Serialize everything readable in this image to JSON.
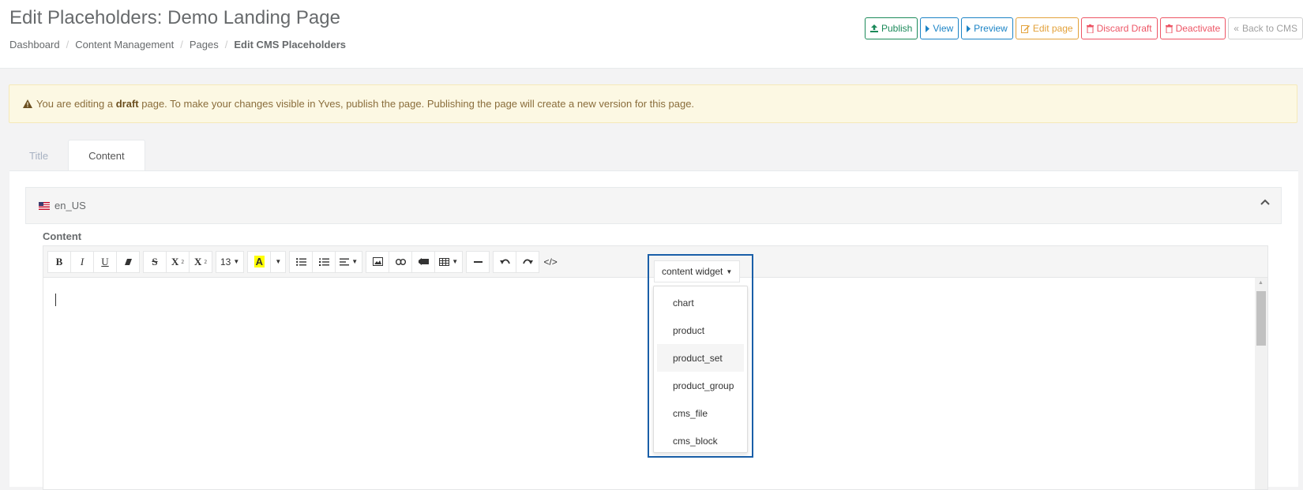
{
  "header": {
    "title": "Edit Placeholders: Demo Landing Page",
    "breadcrumb": [
      "Dashboard",
      "Content Management",
      "Pages",
      "Edit CMS Placeholders"
    ]
  },
  "actions": {
    "publish": {
      "label": "Publish",
      "icon": "upload-icon",
      "color": "#1c8a5a"
    },
    "view": {
      "label": "View",
      "icon": "caret-right-icon",
      "color": "#1c84c6"
    },
    "preview": {
      "label": "Preview",
      "icon": "caret-right-icon",
      "color": "#1c84c6"
    },
    "edit_page": {
      "label": "Edit page",
      "icon": "edit-icon",
      "color": "#e3a23b"
    },
    "discard_draft": {
      "label": "Discard Draft",
      "icon": "trash-icon",
      "color": "#ed5565"
    },
    "deactivate": {
      "label": "Deactivate",
      "icon": "trash-icon",
      "color": "#ed5565"
    },
    "back": {
      "label": "Back to CMS",
      "icon": "double-chevron-left-icon",
      "color": "#a0a0a0"
    }
  },
  "alert": {
    "prefix": "You are editing a",
    "strong": "draft",
    "suffix": "page. To make your changes visible in Yves, publish the page. Publishing the page will create a new version for this page."
  },
  "tabs": [
    {
      "label": "Title",
      "active": false
    },
    {
      "label": "Content",
      "active": true
    }
  ],
  "locale": {
    "name": "en_US",
    "flag_icon": "us-flag-icon"
  },
  "editor": {
    "field_label": "Content",
    "toolbar": {
      "bold": "B",
      "italic": "I",
      "underline": "U",
      "strike": "S",
      "superscript": "X",
      "subscript": "X",
      "font_size": "13",
      "highlight": "A",
      "code_view": "</>",
      "content_widget": "content widget"
    },
    "content_widget_options": [
      "chart",
      "product",
      "product_set",
      "product_group",
      "cms_file",
      "cms_block"
    ],
    "hovered_option": "product_set"
  }
}
